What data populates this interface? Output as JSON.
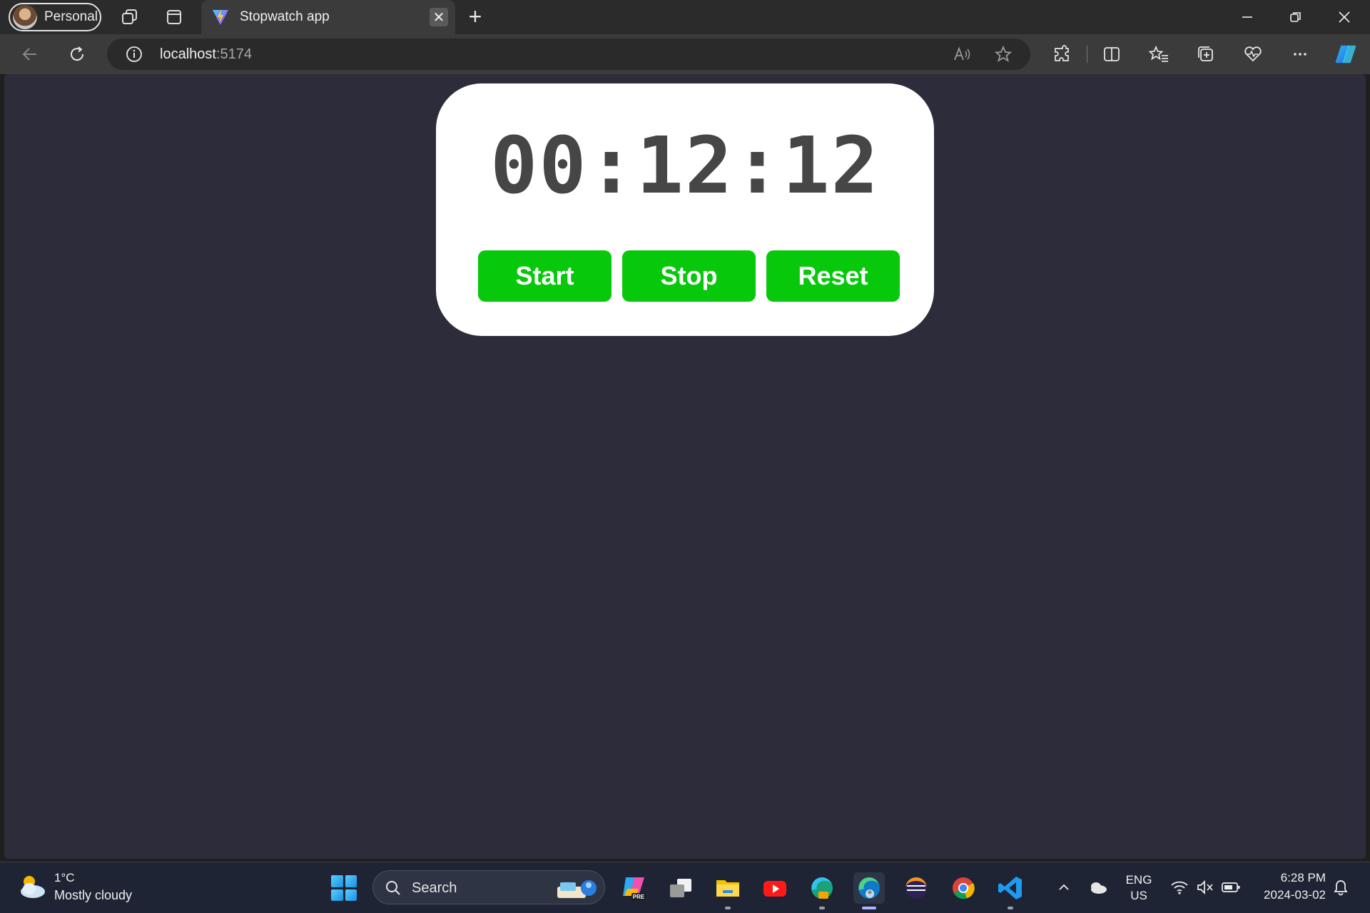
{
  "browser": {
    "profile_label": "Personal",
    "tab_title": "Stopwatch app",
    "tab_close_glyph": "✕",
    "new_tab_glyph": "+",
    "url_host": "localhost",
    "url_port": ":5174"
  },
  "stopwatch": {
    "time_display": "00:12:12",
    "buttons": {
      "start": "Start",
      "stop": "Stop",
      "reset": "Reset"
    },
    "button_color": "#08c80b",
    "card_color": "#ffffff",
    "page_background": "#2d2c3a"
  },
  "taskbar": {
    "weather_temp": "1°C",
    "weather_desc": "Mostly cloudy",
    "search_label": "Search",
    "lang_line1": "ENG",
    "lang_line2": "US",
    "time": "6:28 PM",
    "date": "2024-03-02"
  }
}
